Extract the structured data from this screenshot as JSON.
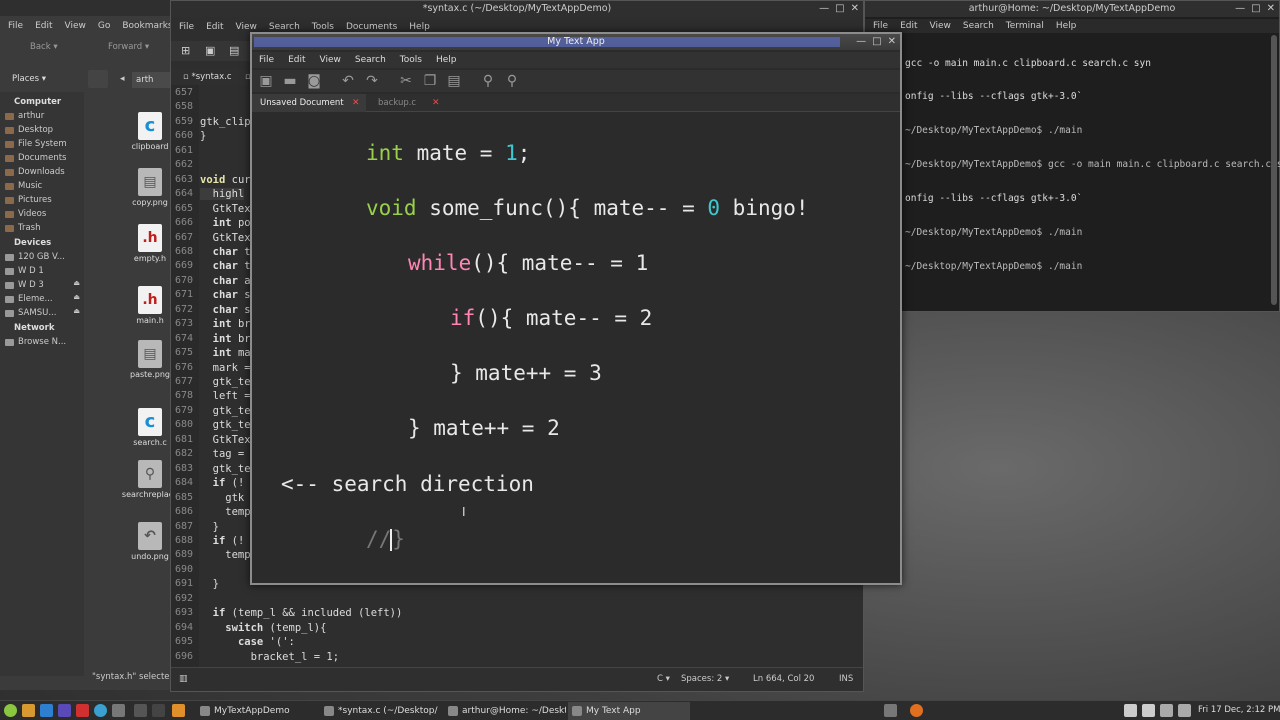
{
  "file_manager": {
    "menu": [
      "File",
      "Edit",
      "View",
      "Go",
      "Bookmarks"
    ],
    "back_label": "Back",
    "forward_label": "Forward",
    "places_label": "Places",
    "path_fragment": "arth",
    "sidebar": {
      "computer_header": "Computer",
      "computer_items": [
        "arthur",
        "Desktop",
        "File System",
        "Documents",
        "Downloads",
        "Music",
        "Pictures",
        "Videos",
        "Trash"
      ],
      "devices_header": "Devices",
      "device_items": [
        "120 GB V...",
        "W D 1",
        "W D 3",
        "Eleme...",
        "SAMSU..."
      ],
      "network_header": "Network",
      "network_items": [
        "Browse N..."
      ]
    },
    "files": [
      {
        "name": "clipboard",
        "glyph": "c"
      },
      {
        "name": "copy.png",
        "glyph": "▤"
      },
      {
        "name": "empty.h",
        "glyph": ".h"
      },
      {
        "name": "main.h",
        "glyph": ".h"
      },
      {
        "name": "paste.png",
        "glyph": "▤"
      },
      {
        "name": "search.c",
        "glyph": "c"
      },
      {
        "name": "searchreplace",
        "glyph": "⚲"
      },
      {
        "name": "undo.png",
        "glyph": "↶"
      }
    ],
    "status": "\"syntax.h\" selected"
  },
  "syntax_editor": {
    "title": "*syntax.c (~/Desktop/MyTextAppDemo)",
    "menu": [
      "File",
      "Edit",
      "View",
      "Search",
      "Tools",
      "Documents",
      "Help"
    ],
    "tabs": [
      {
        "label": "*syntax.c"
      },
      {
        "label": "arth"
      }
    ],
    "line_numbers": [
      "657",
      "658",
      "659",
      "660",
      "661",
      "662",
      "663",
      "664",
      "665",
      "666",
      "667",
      "668",
      "669",
      "670",
      "671",
      "672",
      "673",
      "674",
      "675",
      "676",
      "677",
      "678",
      "679",
      "680",
      "681",
      "682",
      "683",
      "684",
      "685",
      "686",
      "687",
      "688",
      "689",
      "690",
      "691",
      "692",
      "693",
      "694",
      "695",
      "696"
    ],
    "visible_code": [
      "",
      "",
      "gtk_clip",
      "}",
      "",
      "",
      "void cur",
      "  highl",
      "  GtkTex",
      "  int po",
      "  GtkTex",
      "  char t",
      "  char t",
      "  char a",
      "  char s",
      "  char s",
      "  int br",
      "  int br",
      "  int ma",
      "  mark =",
      "  gtk_te",
      "  left =",
      "  gtk_te",
      "  gtk_te",
      "  GtkTex",
      "  tag =",
      "  gtk_te",
      "  if (!",
      "    gtk",
      "    temp",
      "  }",
      "  if (!",
      "    temp",
      "",
      "  }",
      "",
      "  if (temp_l && included (left))",
      "    switch (temp_l){",
      "      case '(':",
      "        bracket_l = 1;"
    ],
    "status": {
      "lang": "C",
      "spaces": "Spaces: 2",
      "position": "Ln 664, Col 20",
      "mode": "INS"
    }
  },
  "terminal": {
    "title": "arthur@Home: ~/Desktop/MyTextAppDemo",
    "menu": [
      "File",
      "Edit",
      "View",
      "Search",
      "Terminal",
      "Help"
    ],
    "lines": [
      "gcc -o main main.c clipboard.c search.c syn",
      "onfig --libs --cflags gtk+-3.0`",
      "~/Desktop/MyTextAppDemo$ ./main",
      "~/Desktop/MyTextAppDemo$ gcc -o main main.c clipboard.c search.c syn",
      "onfig --libs --cflags gtk+-3.0`",
      "~/Desktop/MyTextAppDemo$ ./main",
      "~/Desktop/MyTextAppDemo$ ./main"
    ]
  },
  "my_text_app": {
    "title": "My Text App",
    "menu": [
      "File",
      "Edit",
      "View",
      "Search",
      "Tools",
      "Help"
    ],
    "tabs": [
      {
        "label": "Unsaved Document"
      },
      {
        "label": "backup.c"
      }
    ],
    "code": {
      "l1_kw": "int",
      "l1_rest": " mate = ",
      "l1_num": "1",
      "l1_end": ";",
      "l2_kw": "void",
      "l2_rest": " some_func(){ mate-- = ",
      "l2_num": "0",
      "l2_end": " bingo!",
      "l3_kw": "while",
      "l3_rest": "(){ mate-- = 1",
      "l4_kw": "if",
      "l4_rest": "(){ mate-- = 2",
      "l5": "} mate++ = 3",
      "l6": "} mate++ = 2",
      "l7": "<-- search direction",
      "l8_comment": "//",
      "l8_brace": "}"
    }
  },
  "taskbar": {
    "tasks": [
      "MyTextAppDemo",
      "*syntax.c (~/Desktop/...",
      "arthur@Home: ~/Deskt...",
      "My Text App"
    ],
    "clock": "Fri 17 Dec, 2:12 PM"
  },
  "colors": {
    "keyword_green": "#9ad14a",
    "keyword_pink": "#ff86b4",
    "number_cyan": "#3ec9d0",
    "close_red": "#e05050"
  }
}
